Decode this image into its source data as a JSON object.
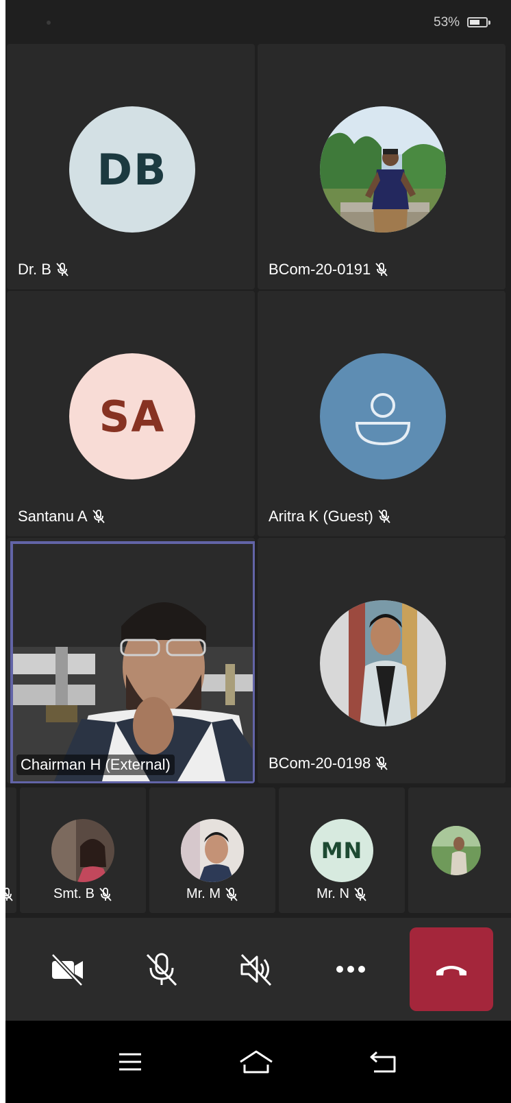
{
  "status_bar": {
    "battery_percent": "53%",
    "battery_level": 0.53
  },
  "tiles": [
    {
      "name": "Dr. B",
      "initials": "DB",
      "avatar_bg": "#d3e0e4",
      "avatar_fg": "#1c3a40",
      "muted": true
    },
    {
      "name": "BCom-20-0191",
      "avatar_type": "photo",
      "muted": true
    },
    {
      "name": "Santanu A",
      "initials": "SA",
      "avatar_bg": "#f8dcd6",
      "avatar_fg": "#873222",
      "muted": true
    },
    {
      "name": "Aritra K (Guest)",
      "avatar_type": "guest-icon",
      "avatar_bg": "#5e8db3",
      "muted": true
    },
    {
      "name": "Chairman H (External)",
      "avatar_type": "video",
      "active_speaker": true,
      "accent": "#6264a7"
    },
    {
      "name": "BCom-20-0198",
      "avatar_type": "photo",
      "muted": true
    }
  ],
  "strip": [
    {
      "name": "Smt. B",
      "avatar_type": "photo",
      "muted": true
    },
    {
      "name": "Mr. M",
      "avatar_type": "photo",
      "muted": true
    },
    {
      "name": "Mr. N",
      "initials": "MN",
      "avatar_bg": "#d7eadf",
      "avatar_fg": "#1d4a32",
      "muted": true
    },
    {
      "name": "",
      "avatar_type": "photo",
      "partial": true
    }
  ],
  "controls": {
    "camera": "camera-off-icon",
    "mic": "mic-off-icon",
    "speaker": "speaker-off-icon",
    "more": "more-icon",
    "hangup": "hang-up-icon",
    "hangup_color": "#a4263b"
  },
  "nav": {
    "menu": "menu-icon",
    "home": "home-icon",
    "back": "back-icon"
  }
}
